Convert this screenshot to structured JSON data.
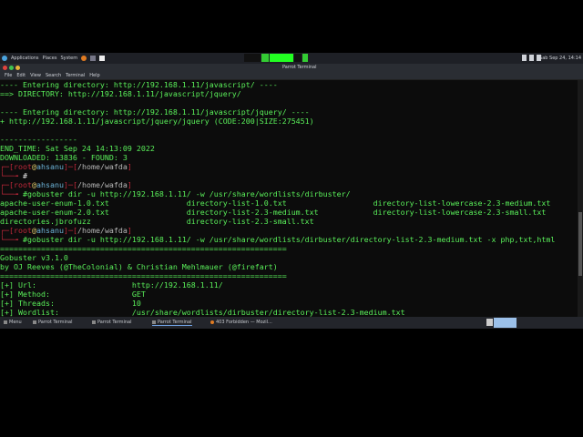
{
  "panel": {
    "applications": "Applications",
    "places": "Places",
    "system": "System",
    "clock": "Sab Sep 24, 14:14"
  },
  "window": {
    "title": "Parrot Terminal",
    "menu": [
      "File",
      "Edit",
      "View",
      "Search",
      "Terminal",
      "Help"
    ]
  },
  "terminal": {
    "lines": [
      [
        [
          "---- Entering directory: http://192.168.1.11/javascript/ ----",
          "g"
        ]
      ],
      [
        [
          "==> DIRECTORY: http://192.168.1.11/javascript/jquery/",
          "g"
        ]
      ],
      [
        [
          "",
          ""
        ]
      ],
      [
        [
          "---- Entering directory: http://192.168.1.11/javascript/jquery/ ----",
          "g"
        ]
      ],
      [
        [
          "+ http://192.168.1.11/javascript/jquery/jquery (CODE:200|SIZE:275451)",
          "g"
        ]
      ],
      [
        [
          "",
          ""
        ]
      ],
      [
        [
          "-----------------",
          "g"
        ]
      ],
      [
        [
          "END_TIME: Sat Sep 24 14:13:09 2022",
          "g"
        ]
      ],
      [
        [
          "DOWNLOADED: 13836 - FOUND: 3",
          "g"
        ]
      ],
      [
        [
          "┌─[",
          "r"
        ],
        [
          "root",
          "r"
        ],
        [
          "@",
          "y"
        ],
        [
          "ahsanu",
          "c"
        ],
        [
          "]─[",
          "r"
        ],
        [
          "/home/wafda",
          "p"
        ],
        [
          "]",
          "r"
        ]
      ],
      [
        [
          "└──╼ ",
          "r"
        ],
        [
          "#",
          "w"
        ]
      ],
      [
        [
          "┌─[",
          "r"
        ],
        [
          "root",
          "r"
        ],
        [
          "@",
          "y"
        ],
        [
          "ahsanu",
          "c"
        ],
        [
          "]─[",
          "r"
        ],
        [
          "/home/wafda",
          "p"
        ],
        [
          "]",
          "r"
        ]
      ],
      [
        [
          "└──╼ ",
          "r"
        ],
        [
          "#gobuster dir -u http://192.168.1.11/ -w /usr/share/wordlists/dirbuster/",
          "g"
        ]
      ],
      [
        [
          "apache-user-enum-1.0.txt                 directory-list-1.0.txt                   directory-list-lowercase-2.3-medium.txt",
          "g"
        ]
      ],
      [
        [
          "apache-user-enum-2.0.txt                 directory-list-2.3-medium.txt            directory-list-lowercase-2.3-small.txt",
          "g"
        ]
      ],
      [
        [
          "directories.jbrofuzz                     directory-list-2.3-small.txt",
          "g"
        ]
      ],
      [
        [
          "┌─[",
          "r"
        ],
        [
          "root",
          "r"
        ],
        [
          "@",
          "y"
        ],
        [
          "ahsanu",
          "c"
        ],
        [
          "]─[",
          "r"
        ],
        [
          "/home/wafda",
          "p"
        ],
        [
          "]",
          "r"
        ]
      ],
      [
        [
          "└──╼ ",
          "r"
        ],
        [
          "#gobuster dir -u http://192.168.1.11/ -w /usr/share/wordlists/dirbuster/directory-list-2.3-medium.txt -x php,txt,html",
          "g"
        ]
      ],
      [
        [
          "===============================================================",
          "g"
        ]
      ],
      [
        [
          "Gobuster v3.1.0",
          "g"
        ]
      ],
      [
        [
          "by OJ Reeves (@TheColonial) & Christian Mehlmauer (@firefart)",
          "g"
        ]
      ],
      [
        [
          "===============================================================",
          "g"
        ]
      ],
      [
        [
          "[+] Url:                     http://192.168.1.11/",
          "g"
        ]
      ],
      [
        [
          "[+] Method:                  GET",
          "g"
        ]
      ],
      [
        [
          "[+] Threads:                 10",
          "g"
        ]
      ],
      [
        [
          "[+] Wordlist:                /usr/share/wordlists/dirbuster/directory-list-2.3-medium.txt",
          "g"
        ]
      ]
    ]
  },
  "taskbar": {
    "menu": "Menu",
    "items": [
      "Parrot Terminal",
      "Parrot Terminal",
      "Parrot Terminal",
      "403 Forbidden — Mozil..."
    ]
  }
}
